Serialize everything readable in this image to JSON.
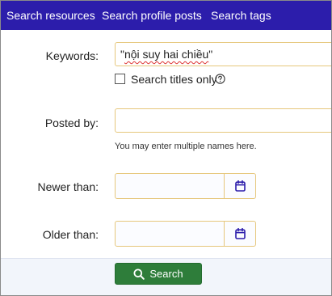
{
  "tabs": {
    "search_resources": "Search resources",
    "search_profile_posts": "Search profile posts",
    "search_tags": "Search tags"
  },
  "form": {
    "keywords_label": "Keywords:",
    "keywords_value_open": "\"",
    "keywords_value_words": "nội suy hai chiều",
    "keywords_value_close": "\"",
    "titles_only_label": "Search titles only",
    "posted_by_label": "Posted by:",
    "posted_by_value": "",
    "posted_by_hint": "You may enter multiple names here.",
    "newer_than_label": "Newer than:",
    "newer_than_value": "",
    "older_than_label": "Older than:",
    "older_than_value": ""
  },
  "actions": {
    "search_label": "Search"
  },
  "icons": {
    "help": "help-circle-icon",
    "calendar": "calendar-icon",
    "search": "search-icon"
  },
  "colors": {
    "tab_bar": "#2c1dab",
    "input_border": "#e6c77c",
    "button_bg": "#2e7d3a",
    "calendar_icon": "#2c1dab"
  }
}
